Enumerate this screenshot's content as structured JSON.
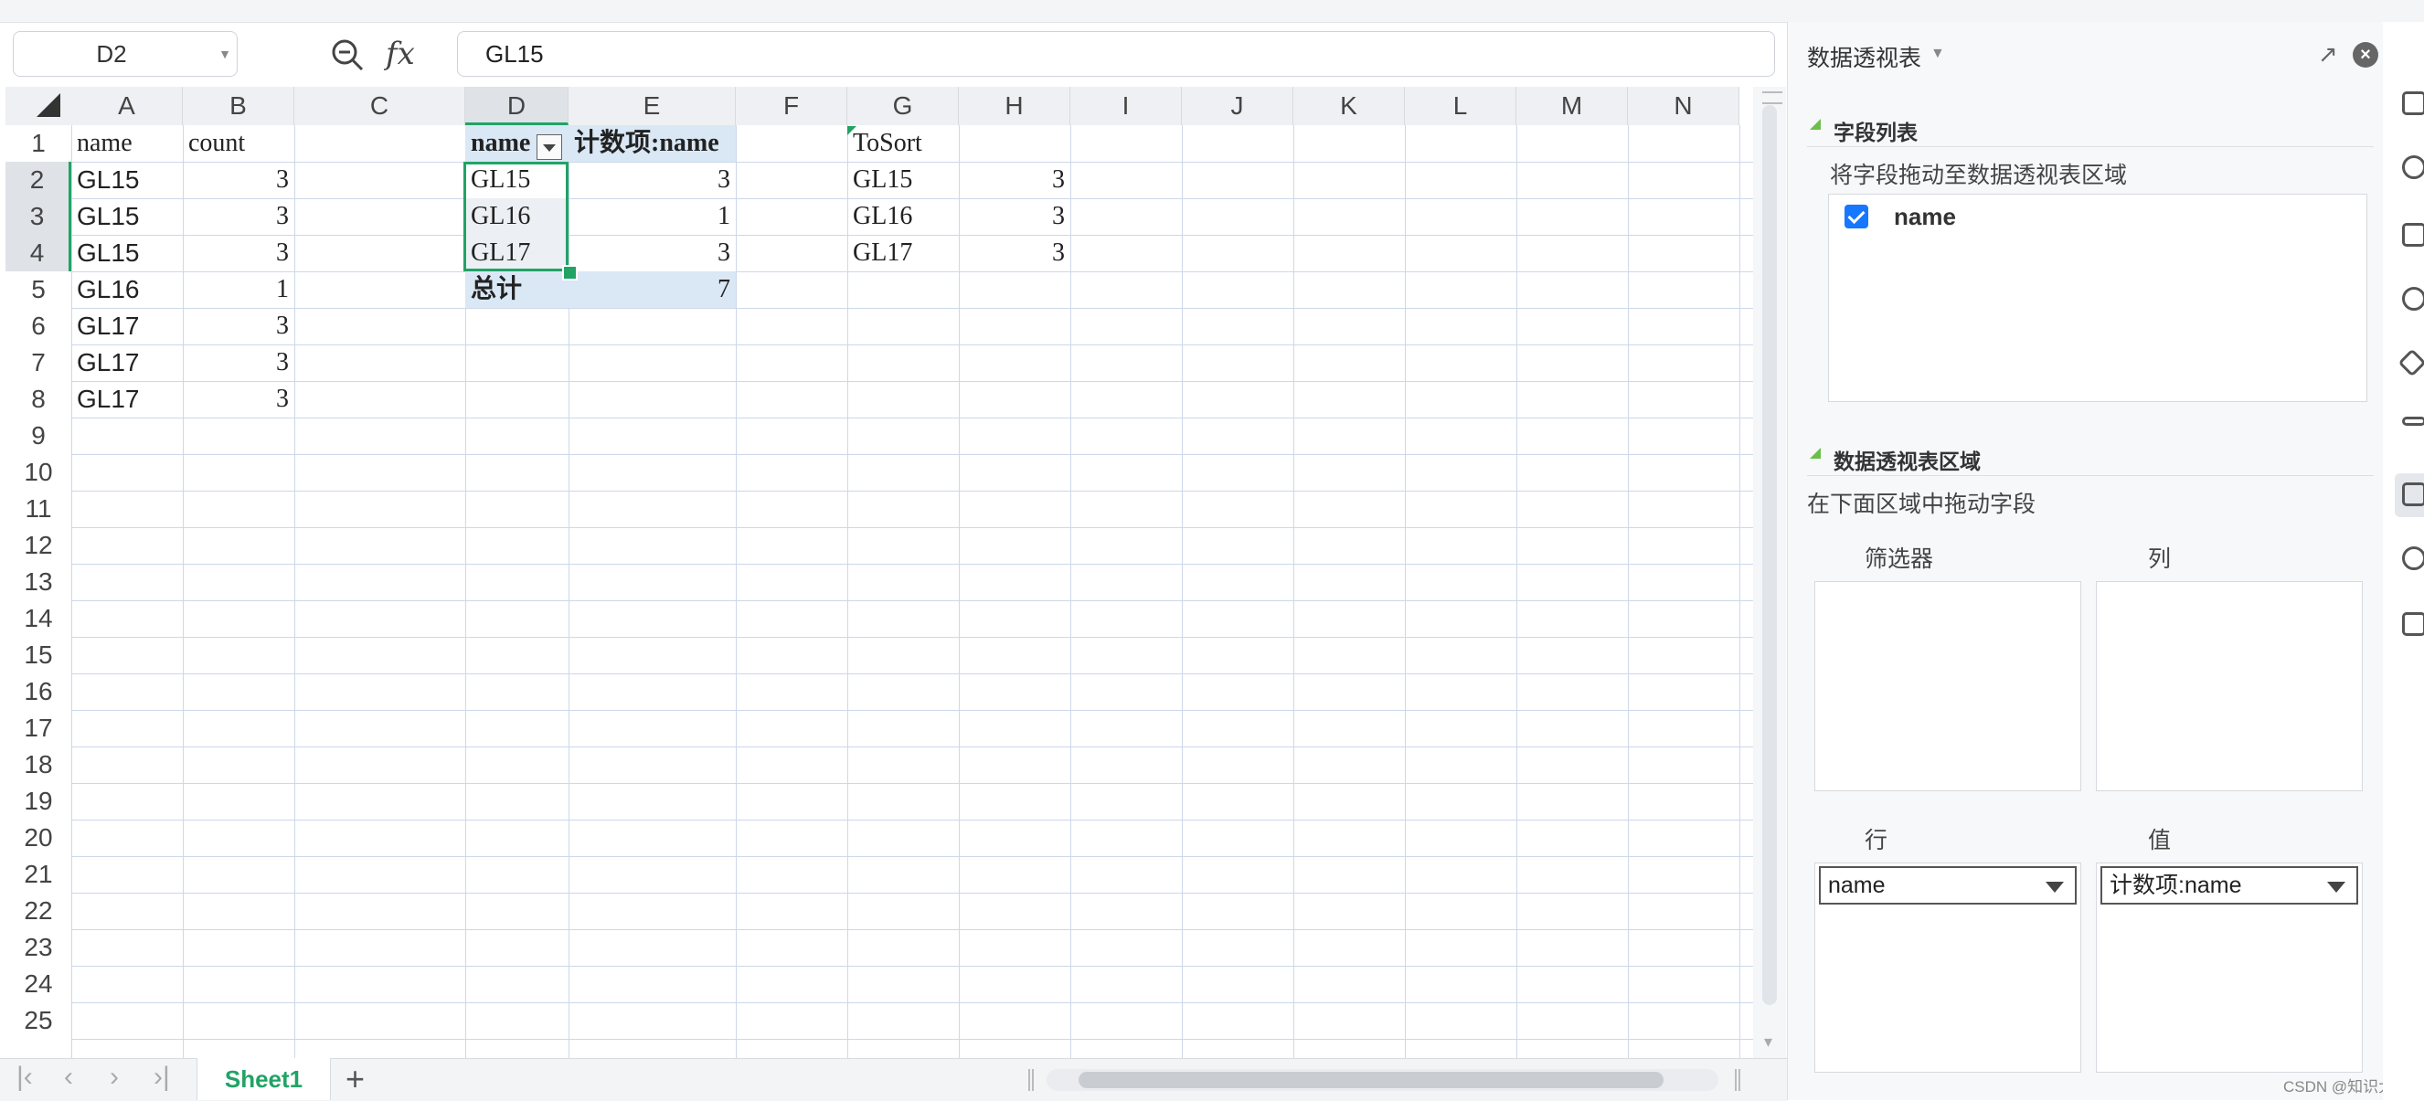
{
  "formula_bar": {
    "cell_ref": "D2",
    "formula": "GL15"
  },
  "columns": [
    "A",
    "B",
    "C",
    "D",
    "E",
    "F",
    "G",
    "H",
    "I",
    "J",
    "K",
    "L",
    "M",
    "N"
  ],
  "rows": [
    "1",
    "2",
    "3",
    "4",
    "5",
    "6",
    "7",
    "8",
    "9",
    "10",
    "11",
    "12",
    "13",
    "14",
    "15",
    "16",
    "17",
    "18",
    "19",
    "20",
    "21",
    "22",
    "23",
    "24",
    "25"
  ],
  "cells": {
    "A1": "name",
    "B1": "count",
    "A2": "GL15",
    "B2": "3",
    "A3": "GL15",
    "B3": "3",
    "A4": "GL15",
    "B4": "3",
    "A5": "GL16",
    "B5": "1",
    "A6": "GL17",
    "B6": "3",
    "A7": "GL17",
    "B7": "3",
    "A8": "GL17",
    "B8": "3",
    "D1": "name",
    "E1": "计数项:name",
    "D2": "GL15",
    "E2": "3",
    "D3": "GL16",
    "E3": "1",
    "D4": "GL17",
    "E4": "3",
    "D5": "总计",
    "E5": "7",
    "G1": "ToSort",
    "G2": "GL15",
    "H2": "3",
    "G3": "GL16",
    "H3": "3",
    "G4": "GL17",
    "H4": "3"
  },
  "sheet_tabs": {
    "active": "Sheet1",
    "add": "+"
  },
  "pivot_panel": {
    "title": "数据透视表",
    "field_list_title": "字段列表",
    "field_list_hint": "将字段拖动至数据透视表区域",
    "fields": [
      {
        "name": "name",
        "checked": true
      }
    ],
    "areas_title": "数据透视表区域",
    "areas_hint": "在下面区域中拖动字段",
    "filter_label": "筛选器",
    "column_label": "列",
    "row_label": "行",
    "value_label": "值",
    "row_field": "name",
    "value_field": "计数项:name"
  },
  "watermark": "CSDN @知识大胖"
}
